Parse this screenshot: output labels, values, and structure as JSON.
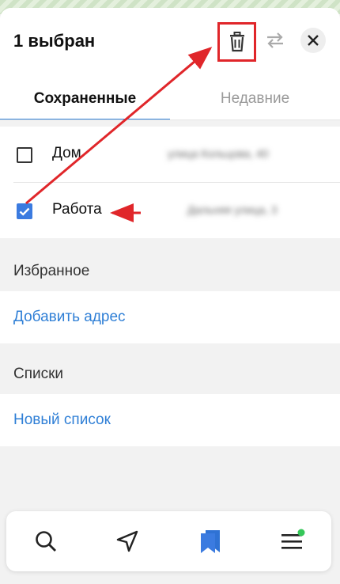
{
  "header": {
    "title": "1 выбран"
  },
  "icons": {
    "delete": "trash-icon",
    "swap": "swap-arrows-icon",
    "close": "close-icon"
  },
  "tabs": [
    {
      "label": "Сохраненные",
      "active": true
    },
    {
      "label": "Недавние",
      "active": false
    }
  ],
  "saved": [
    {
      "label": "Дом",
      "checked": false,
      "address": "улица Кольцова, 40"
    },
    {
      "label": "Работа",
      "checked": true,
      "address": "Дальняя улица, 3"
    }
  ],
  "favorites": {
    "title": "Избранное",
    "add_link": "Добавить адрес"
  },
  "lists": {
    "title": "Списки",
    "new_link": "Новый список"
  },
  "bottom_nav": [
    {
      "icon": "search-icon"
    },
    {
      "icon": "navigation-arrow-icon"
    },
    {
      "icon": "bookmarks-icon",
      "active": true
    },
    {
      "icon": "menu-icon",
      "badge": true
    }
  ],
  "colors": {
    "accent": "#2f7fd6",
    "annotation_red": "#e0262a",
    "checkbox_blue": "#3b7be0",
    "badge_green": "#35c759"
  }
}
